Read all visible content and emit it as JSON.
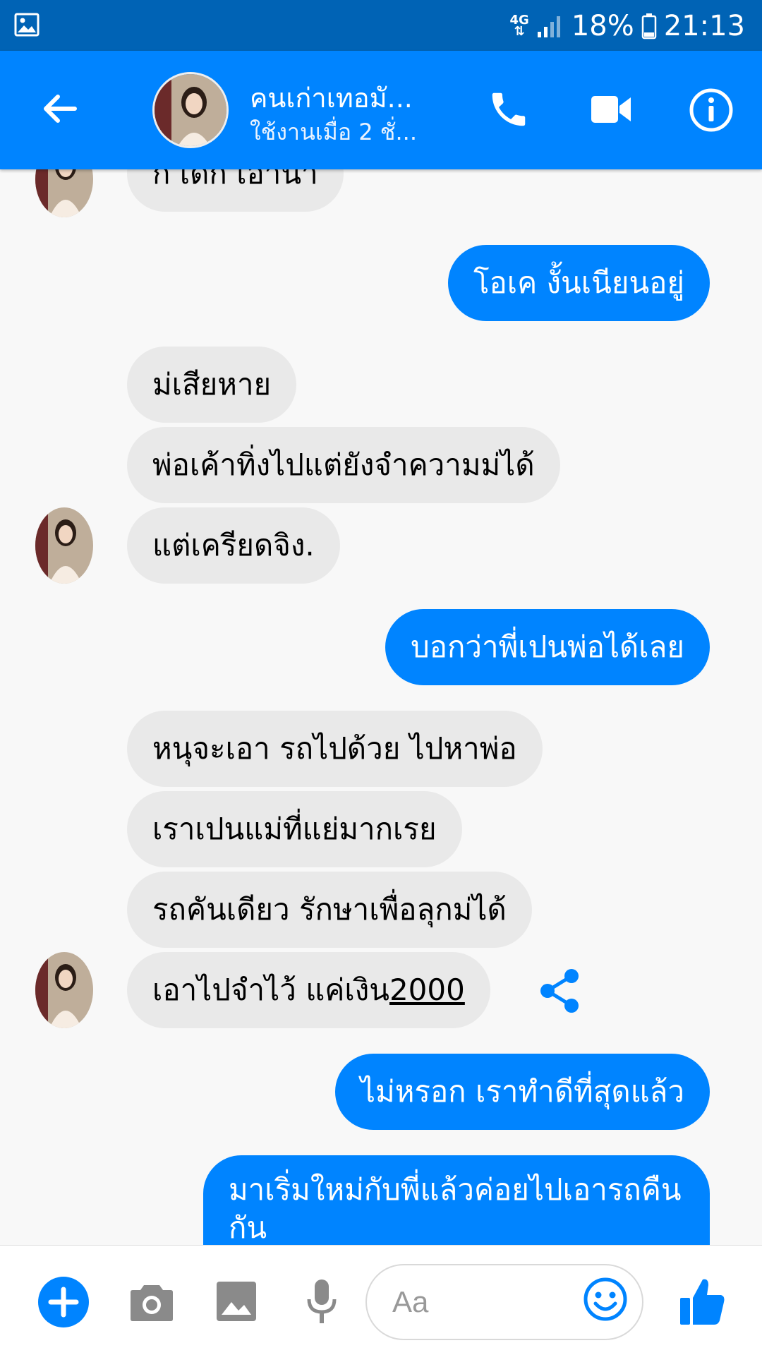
{
  "status_bar": {
    "network": "4G",
    "battery": "18%",
    "time": "21:13"
  },
  "header": {
    "contact_name": "คนเก่าเทอมั...",
    "status": "ใช้งานเมื่อ 2 ชั่..."
  },
  "messages": [
    {
      "side": "in",
      "text": "ก่ เด้ก เอาน่า"
    },
    {
      "side": "out",
      "text": "โอเค งั้นเนียนอยู่"
    },
    {
      "side": "in",
      "text": "ม่เสียหาย"
    },
    {
      "side": "in",
      "text": "พ่อเค้าทิ่งไปแต่ยังจำความม่ได้"
    },
    {
      "side": "in",
      "text": "แต่เครียดจิง."
    },
    {
      "side": "out",
      "text": "บอกว่าพี่เปนพ่อได้เลย"
    },
    {
      "side": "in",
      "text": "หนุจะเอา รถไปด้วย ไปหาพ่อ"
    },
    {
      "side": "in",
      "text": "เราเปนแม่ที่แย่มากเรย"
    },
    {
      "side": "in",
      "text": "รถคันเดียว รักษาเพื่อลุกม่ได้"
    },
    {
      "side": "in",
      "text": "เอาไปจำไว้  แค่เงิน",
      "amount": "2000"
    },
    {
      "side": "out",
      "text": "ไม่หรอก เราทำดีที่สุดแล้ว"
    },
    {
      "side": "out",
      "text": "มาเริ่มใหม่กับพี่แล้วค่อยไปเอารถคืนกัน"
    }
  ],
  "composer": {
    "placeholder": "Aa"
  },
  "colors": {
    "header": "#0084ff",
    "status_bar": "#0063b5",
    "outgoing_bubble": "#0084ff",
    "incoming_bubble": "#e9e9e9"
  }
}
